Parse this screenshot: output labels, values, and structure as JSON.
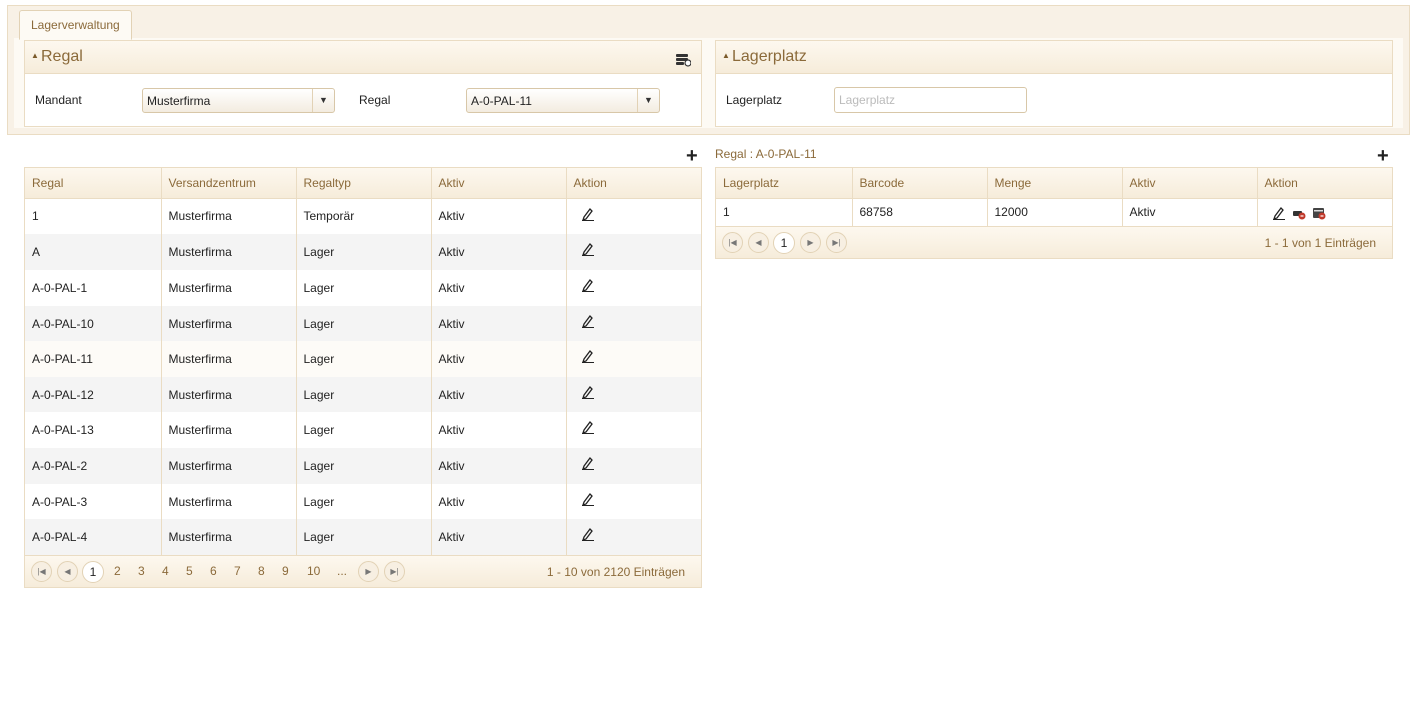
{
  "tab": {
    "label": "Lagerverwaltung"
  },
  "regal_panel": {
    "title": "Regal",
    "mandant_label": "Mandant",
    "mandant_value": "Musterfirma",
    "regal_label": "Regal",
    "regal_value": "A-0-PAL-11"
  },
  "lagerplatz_panel": {
    "title": "Lagerplatz",
    "lagerplatz_label": "Lagerplatz",
    "lagerplatz_placeholder": "Lagerplatz"
  },
  "regal_grid": {
    "headers": [
      "Regal",
      "Versandzentrum",
      "Regaltyp",
      "Aktiv",
      "Aktion"
    ],
    "rows": [
      [
        "1",
        "Musterfirma",
        "Temporär",
        "Aktiv"
      ],
      [
        "A",
        "Musterfirma",
        "Lager",
        "Aktiv"
      ],
      [
        "A-0-PAL-1",
        "Musterfirma",
        "Lager",
        "Aktiv"
      ],
      [
        "A-0-PAL-10",
        "Musterfirma",
        "Lager",
        "Aktiv"
      ],
      [
        "A-0-PAL-11",
        "Musterfirma",
        "Lager",
        "Aktiv"
      ],
      [
        "A-0-PAL-12",
        "Musterfirma",
        "Lager",
        "Aktiv"
      ],
      [
        "A-0-PAL-13",
        "Musterfirma",
        "Lager",
        "Aktiv"
      ],
      [
        "A-0-PAL-2",
        "Musterfirma",
        "Lager",
        "Aktiv"
      ],
      [
        "A-0-PAL-3",
        "Musterfirma",
        "Lager",
        "Aktiv"
      ],
      [
        "A-0-PAL-4",
        "Musterfirma",
        "Lager",
        "Aktiv"
      ]
    ],
    "pager": {
      "current": "1",
      "pages": [
        "2",
        "3",
        "4",
        "5",
        "6",
        "7",
        "8",
        "9",
        "10",
        "..."
      ],
      "info": "1 - 10 von 2120 Einträgen"
    }
  },
  "lagerplatz_grid": {
    "caption": "Regal : A-0-PAL-11",
    "headers": [
      "Lagerplatz",
      "Barcode",
      "Menge",
      "Aktiv",
      "Aktion"
    ],
    "rows": [
      [
        "1",
        "68758",
        "12000",
        "Aktiv"
      ]
    ],
    "pager": {
      "current": "1",
      "info": "1 - 1 von 1 Einträgen"
    }
  },
  "icons": {
    "add": "plus-icon",
    "edit": "edit-pencil-icon",
    "config": "config-icon",
    "first": "first-page-icon",
    "prev": "prev-page-icon",
    "next": "next-page-icon",
    "last": "last-page-icon"
  },
  "colors": {
    "accent": "#8b6a3a",
    "border": "#eadcc3",
    "header_bg": "#f6ecda"
  }
}
